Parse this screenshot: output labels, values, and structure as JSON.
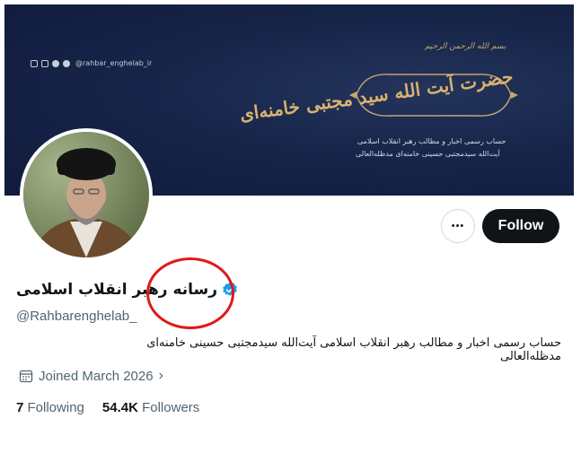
{
  "banner": {
    "handle": "@rahbar_enghelab_ir",
    "basmala": "بسم الله الرحمن الرحیم",
    "calligraphy": "حضرت آیت الله سید مجتبی خامنه‌ای",
    "subline_1": "حساب رسمی اخبار و مطالب رهبر انقلاب اسلامی",
    "subline_2": "آیت‌الله سیدمجتبی حسینی خامنه‌ای مدظله‌العالی"
  },
  "profile": {
    "display_name": "رسانه رهبر انقلاب اسلامی",
    "handle": "@Rahbarenghelab_",
    "bio": "حساب رسمی اخبار و مطالب رهبر انقلاب اسلامی آیت‌الله سیدمجتبی حسینی خامنه‌ای مدظله‌العالی",
    "joined": "Joined March 2026"
  },
  "actions": {
    "more_label": "•••",
    "follow_label": "Follow"
  },
  "stats": {
    "following_count": "7",
    "following_label": "Following",
    "followers_count": "54.4K",
    "followers_label": "Followers"
  },
  "icons": {
    "more": "more-icon",
    "verified": "verified-badge-icon",
    "calendar": "calendar-icon",
    "chevron": "chevron-right-icon"
  },
  "colors": {
    "follow_bg": "#0f1419",
    "verified": "#1d9bf0",
    "annotation_ring": "#e01818",
    "banner_gold": "#d9b26c"
  }
}
